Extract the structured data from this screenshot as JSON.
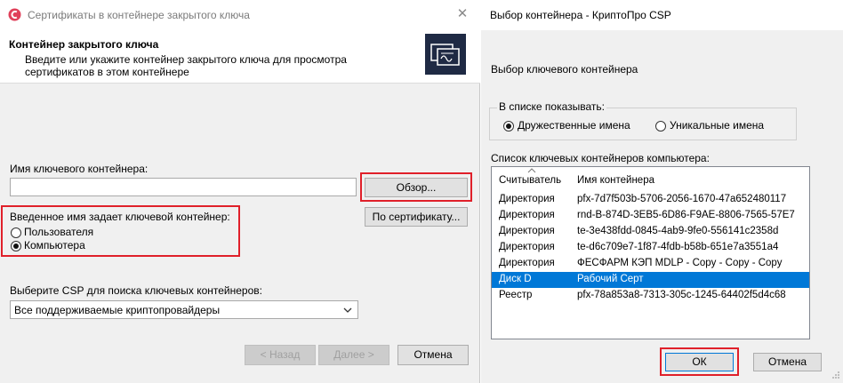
{
  "left_dialog": {
    "title": "Сертификаты в контейнере закрытого ключа",
    "close_glyph": "✕",
    "header_title": "Контейнер закрытого ключа",
    "header_subtitle_1": "Введите или укажите контейнер закрытого ключа для просмотра",
    "header_subtitle_2": "сертификатов в этом контейнере",
    "container_name_label": "Имя ключевого контейнера:",
    "container_name_value": "",
    "browse_button": "Обзор...",
    "by_cert_button": "По сертификату...",
    "key_scope_label": "Введенное имя задает ключевой контейнер:",
    "radio_user": "Пользователя",
    "radio_computer": "Компьютера",
    "csp_label": "Выберите CSP для поиска ключевых контейнеров:",
    "csp_selected": "Все поддерживаемые криптопровайдеры",
    "back_button": "< Назад",
    "next_button": "Далее >",
    "cancel_button": "Отмена"
  },
  "right_dialog": {
    "title": "Выбор контейнера - КриптоПро CSP",
    "section_label": "Выбор ключевого контейнера",
    "show_group_label": "В списке показывать:",
    "radio_friendly": "Дружественные имена",
    "radio_unique": "Уникальные имена",
    "list_label": "Список ключевых контейнеров компьютера:",
    "columns": {
      "reader": "Считыватель",
      "container": "Имя контейнера"
    },
    "rows": [
      {
        "reader": "Директория",
        "container": "pfx-7d7f503b-5706-2056-1670-47a652480117"
      },
      {
        "reader": "Директория",
        "container": "rnd-B-874D-3EB5-6D86-F9AE-8806-7565-57E7"
      },
      {
        "reader": "Директория",
        "container": "te-3e438fdd-0845-4ab9-9fe0-556141c2358d"
      },
      {
        "reader": "Директория",
        "container": "te-d6c709e7-1f87-4fdb-b58b-651e7a3551a4"
      },
      {
        "reader": "Директория",
        "container": "ФЕСФАРМ КЭП MDLP - Copy - Copy - Copy"
      },
      {
        "reader": "Диск D",
        "container": "Рабочий Серт"
      },
      {
        "reader": "Реестр",
        "container": "pfx-78a853a8-7313-305c-1245-64402f5d4c68"
      }
    ],
    "selected_row": 5,
    "ok_button": "ОК",
    "cancel_button": "Отмена"
  },
  "colors": {
    "highlight_box": "#e0202a",
    "selection": "#0078d7",
    "accent_icon": "#e0405a"
  }
}
